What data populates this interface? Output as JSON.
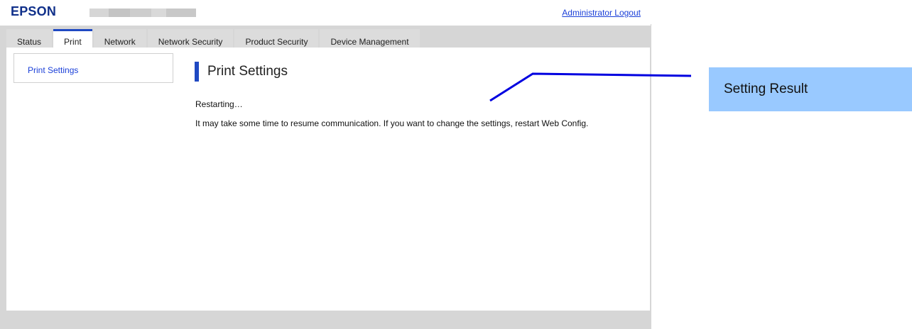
{
  "header": {
    "logo": "EPSON",
    "logout_link": "Administrator Logout"
  },
  "tabs": [
    {
      "label": "Status"
    },
    {
      "label": "Print"
    },
    {
      "label": "Network"
    },
    {
      "label": "Network Security"
    },
    {
      "label": "Product Security"
    },
    {
      "label": "Device Management"
    }
  ],
  "active_tab": "Print",
  "sidebar": {
    "items": [
      {
        "label": "Print Settings"
      }
    ]
  },
  "main": {
    "heading": "Print Settings",
    "status": "Restarting…",
    "message": "It may take some time to resume communication. If you want to change the settings, restart Web Config."
  },
  "callout": {
    "label": "Setting Result"
  },
  "colors": {
    "brand": "#10308a",
    "accent": "#1f49c2",
    "link": "#1a3fd8",
    "callout_bg": "#99c9ff"
  }
}
